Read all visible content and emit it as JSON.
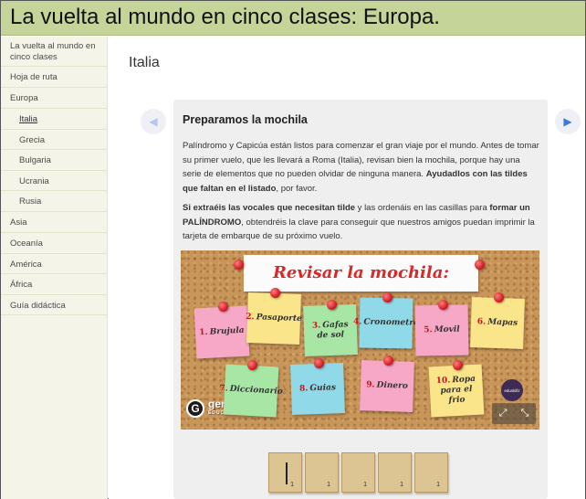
{
  "header": {
    "title": "La vuelta al mundo en cinco clases: Europa."
  },
  "sidebar": {
    "items": [
      {
        "label": "La vuelta al mundo en cinco clases",
        "level": 0,
        "active": false
      },
      {
        "label": "Hoja de ruta",
        "level": 0,
        "active": false
      },
      {
        "label": "Europa",
        "level": 0,
        "active": false
      },
      {
        "label": "Italia",
        "level": 1,
        "active": true
      },
      {
        "label": "Grecia",
        "level": 1,
        "active": false
      },
      {
        "label": "Bulgaria",
        "level": 1,
        "active": false
      },
      {
        "label": "Ucrania",
        "level": 1,
        "active": false
      },
      {
        "label": "Rusia",
        "level": 1,
        "active": false
      },
      {
        "label": "Asia",
        "level": 0,
        "active": false
      },
      {
        "label": "Oceanía",
        "level": 0,
        "active": false
      },
      {
        "label": "América",
        "level": 0,
        "active": false
      },
      {
        "label": "África",
        "level": 0,
        "active": false
      },
      {
        "label": "Guía didáctica",
        "level": 0,
        "active": false
      }
    ]
  },
  "main": {
    "page_title": "Italia",
    "prev_icon": "◀",
    "next_icon": "▶",
    "card": {
      "title": "Preparamos la mochila",
      "p1_text": "Palíndromo y Capicúa están listos para comenzar el gran viaje por el mundo. Antes de tomar su primer vuelo, que les llevará a Roma (Italia), revisan bien la mochila, porque hay una serie de elementos que no pueden olvidar de ninguna manera.",
      "p1_bold": "Ayudadlos con las tildes que faltan en el listado",
      "p1_end": ", por favor.",
      "p2_bold1": "Si extraéis las vocales que necesitan tilde",
      "p2_mid": " y las ordenáis en las casillas para ",
      "p2_bold2": "formar un PALÍNDROMO",
      "p2_end": ", obtendréis la clave para conseguir que nuestros amigos puedan imprimir la tarjeta de embarque de su próximo vuelo."
    },
    "board": {
      "title": "Revisar la mochila:",
      "notes": [
        {
          "num": "1.",
          "word": "Brujula",
          "color": "pink"
        },
        {
          "num": "2.",
          "word": "Pasaporte",
          "color": "yellow"
        },
        {
          "num": "3.",
          "word": "Gafas de sol",
          "color": "green"
        },
        {
          "num": "4.",
          "word": "Cronometro",
          "color": "cyan"
        },
        {
          "num": "5.",
          "word": "Movil",
          "color": "pink"
        },
        {
          "num": "6.",
          "word": "Mapas",
          "color": "yellow"
        },
        {
          "num": "7.",
          "word": "Diccionario",
          "color": "green"
        },
        {
          "num": "8.",
          "word": "Guias",
          "color": "cyan"
        },
        {
          "num": "9.",
          "word": "Dinero",
          "color": "pink"
        },
        {
          "num": "10.",
          "word": "Ropa para el frio",
          "color": "yellow"
        }
      ],
      "brand": "genially",
      "brand_sub": "EDUCATION",
      "badge": "eduskillz",
      "share_icon": "share-icon",
      "fullscreen_icon": "fullscreen-icon"
    },
    "tiles": [
      {
        "value": "1"
      },
      {
        "value": "1"
      },
      {
        "value": "1"
      },
      {
        "value": "1"
      },
      {
        "value": "1"
      }
    ]
  }
}
